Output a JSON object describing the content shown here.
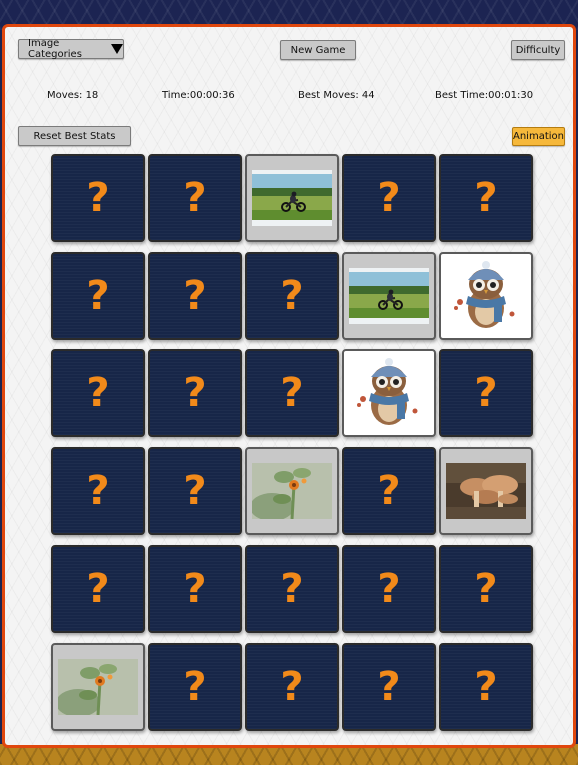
{
  "toolbar": {
    "categories_label": "Image Categories",
    "new_game_label": "New Game",
    "difficulty_label": "Difficulty",
    "reset_label": "Reset Best Stats",
    "animation_label": "Animation"
  },
  "stats": {
    "moves": "Moves: 18",
    "time": "Time:00:00:36",
    "best_moves": "Best Moves: 44",
    "best_time": "Best Time:00:01:30"
  },
  "board": {
    "hidden_symbol": "?",
    "rows": [
      [
        "hidden",
        "hidden",
        "motorcycle",
        "hidden",
        "hidden"
      ],
      [
        "hidden",
        "hidden",
        "hidden",
        "motorcycle",
        "owl"
      ],
      [
        "hidden",
        "hidden",
        "hidden",
        "owl",
        "hidden"
      ],
      [
        "hidden",
        "hidden",
        "flower",
        "hidden",
        "mushroom"
      ],
      [
        "hidden",
        "hidden",
        "hidden",
        "hidden",
        "hidden"
      ],
      [
        "flower",
        "hidden",
        "hidden",
        "hidden",
        "hidden"
      ]
    ]
  },
  "colors": {
    "card_back": "#172648",
    "question_mark": "#f28a1a",
    "frame_border": "#e0470d",
    "animation_button": "#f6b83b"
  }
}
